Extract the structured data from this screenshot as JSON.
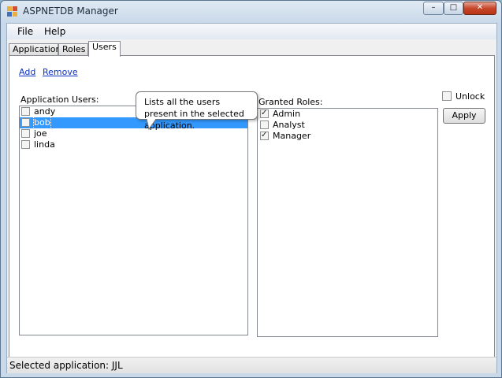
{
  "window": {
    "title": "ASPNETDB Manager",
    "controls": {
      "minimize": "–",
      "maximize": "□",
      "close": "✕"
    }
  },
  "menu": {
    "file": "File",
    "help": "Help"
  },
  "tabs": [
    {
      "label": "Applications",
      "active": false
    },
    {
      "label": "Roles",
      "active": false
    },
    {
      "label": "Users",
      "active": true
    }
  ],
  "actions": {
    "add": "Add",
    "remove": "Remove"
  },
  "users_panel": {
    "label": "Application Users:",
    "users": [
      {
        "name": "andy",
        "checked": false,
        "selected": false
      },
      {
        "name": "bob",
        "checked": false,
        "selected": true
      },
      {
        "name": "joe",
        "checked": false,
        "selected": false
      },
      {
        "name": "linda",
        "checked": false,
        "selected": false
      }
    ]
  },
  "tooltip": {
    "text": "Lists all the users present in the selected application."
  },
  "roles_panel": {
    "label": "Granted Roles:",
    "roles": [
      {
        "name": "Admin",
        "checked": true
      },
      {
        "name": "Analyst",
        "checked": false
      },
      {
        "name": "Manager",
        "checked": true
      }
    ]
  },
  "unlock": {
    "label": "Unlock",
    "checked": false
  },
  "apply_button": {
    "label": "Apply"
  },
  "status": {
    "text": "Selected application: JJL"
  },
  "colors": {
    "selection": "#3399ff",
    "link": "#1030c0",
    "close": "#c7472b"
  }
}
